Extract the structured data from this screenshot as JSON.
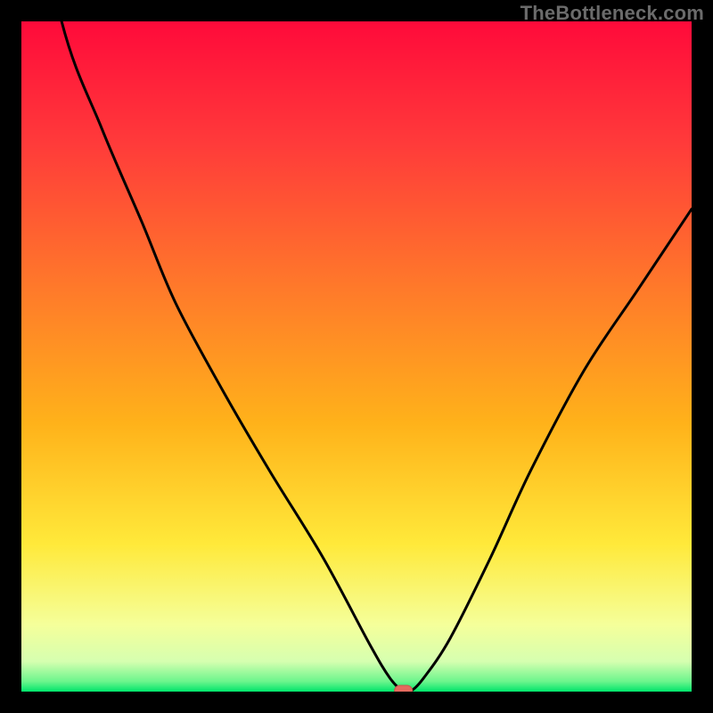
{
  "attribution": "TheBottleneck.com",
  "colors": {
    "frame": "#000000",
    "curve": "#000000",
    "marker_fill": "#e46a5e",
    "marker_stroke": "#c8574c",
    "gradient_stops": [
      {
        "offset": 0.0,
        "color": "#ff0a3a"
      },
      {
        "offset": 0.18,
        "color": "#ff3a3a"
      },
      {
        "offset": 0.4,
        "color": "#ff7a2a"
      },
      {
        "offset": 0.6,
        "color": "#ffb21a"
      },
      {
        "offset": 0.78,
        "color": "#ffe93a"
      },
      {
        "offset": 0.9,
        "color": "#f5ff9a"
      },
      {
        "offset": 0.955,
        "color": "#d6ffb0"
      },
      {
        "offset": 0.985,
        "color": "#6bf58c"
      },
      {
        "offset": 1.0,
        "color": "#00e56b"
      }
    ]
  },
  "chart_data": {
    "type": "line",
    "title": "",
    "xlabel": "",
    "ylabel": "",
    "xlim": [
      0,
      100
    ],
    "ylim": [
      0,
      100
    ],
    "x": [
      0,
      6,
      12,
      18,
      23,
      30,
      37,
      45,
      52,
      55,
      57,
      58,
      60,
      64,
      70,
      76,
      84,
      92,
      100
    ],
    "series": [
      {
        "name": "bottleneck-curve",
        "values": [
          130,
          100,
          84,
          70,
          58,
          45,
          33,
          20,
          7,
          2,
          0,
          0,
          2,
          8,
          20,
          33,
          48,
          60,
          72
        ]
      }
    ],
    "marker": {
      "x": 57,
      "y": 0
    },
    "grid": false,
    "legend": false
  }
}
